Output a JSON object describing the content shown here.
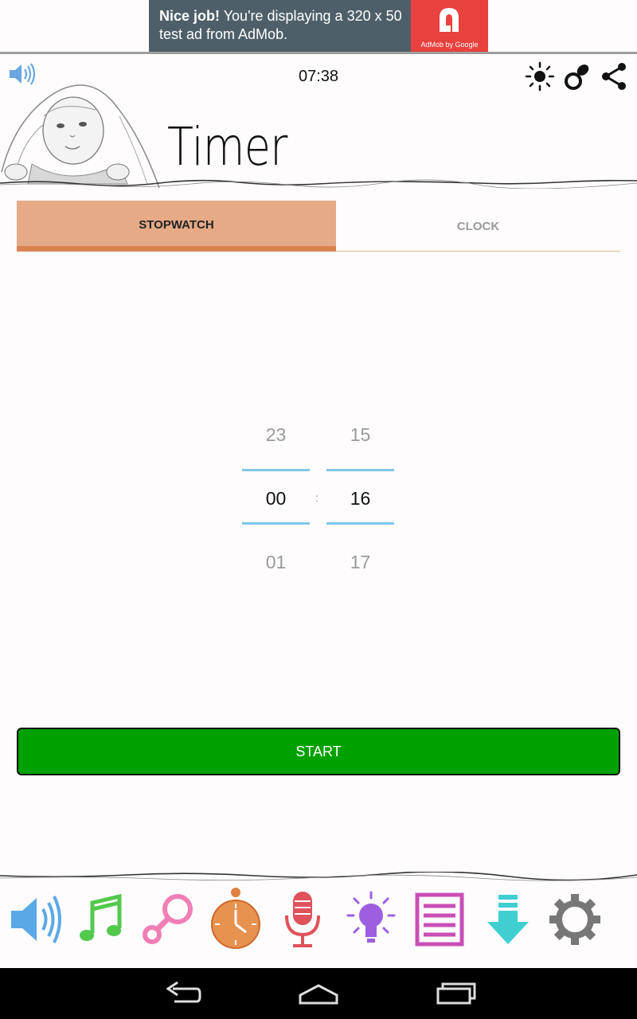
{
  "ad": {
    "headline": "Nice job!",
    "text": " You're displaying a 320 x 50 test ad from AdMob.",
    "logo_caption": "AdMob by Google"
  },
  "header": {
    "time": "07:38",
    "title": "Timer"
  },
  "tabs": [
    {
      "label": "STOPWATCH",
      "active": true
    },
    {
      "label": "CLOCK",
      "active": false
    }
  ],
  "picker": {
    "hours": {
      "prev": "23",
      "current": "00",
      "next": "01"
    },
    "minutes": {
      "prev": "15",
      "current": "16",
      "next": "17"
    },
    "separator": ":"
  },
  "start_label": "START",
  "toolbar": {
    "items": [
      "speaker-icon",
      "music-note-icon",
      "rattle-icon",
      "stopwatch-icon",
      "microphone-icon",
      "light-bulb-icon",
      "list-icon",
      "download-icon",
      "gear-icon"
    ]
  },
  "colors": {
    "accent_tab": "#e6aa86",
    "accent_tab_underline": "#d98352",
    "start_button": "#00a000",
    "picker_line": "#7ec7e6"
  }
}
